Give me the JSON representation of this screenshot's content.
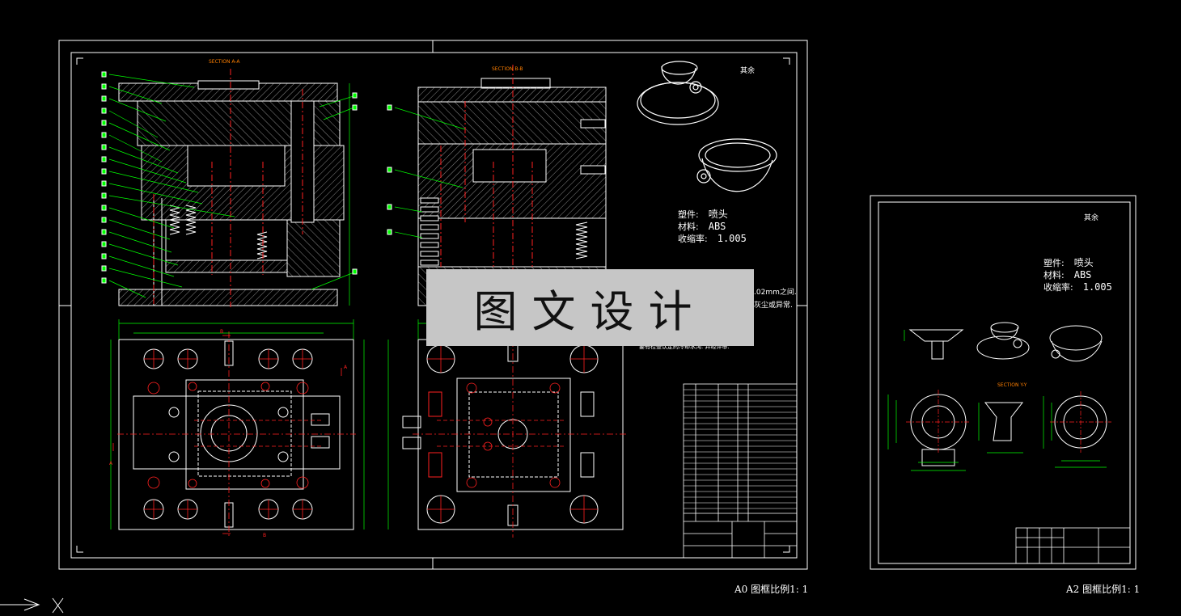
{
  "drawing": {
    "a0_caption": "A0 图框比例1: 1",
    "a2_caption": "A2 图框比例1: 1",
    "section_aa": "SECTION A-A",
    "section_bb": "SECTION B-B",
    "section_yy": "SECTION Y-Y",
    "roughness": "其余",
    "part_info": {
      "name_label": "塑件:",
      "name_value": "喷头",
      "material_label": "材料:",
      "material_value": "ABS",
      "shrink_label": "收缩率:",
      "shrink_value": "1.005"
    },
    "note_fragment_1": ".02mm之间.",
    "note_fragment_2": "灰尘或异常.",
    "note_fragment_3": "要有检查认定的冷却水沟. 并经评审.",
    "watermark": "图文设计"
  },
  "colors": {
    "background": "#000000",
    "line": "#ffffff",
    "center": "#ff2020",
    "dim": "#00ff00",
    "hatch": "#9a9a9a",
    "section": "#ff7f00"
  },
  "ucs_icon": "ucs-axis-icon"
}
